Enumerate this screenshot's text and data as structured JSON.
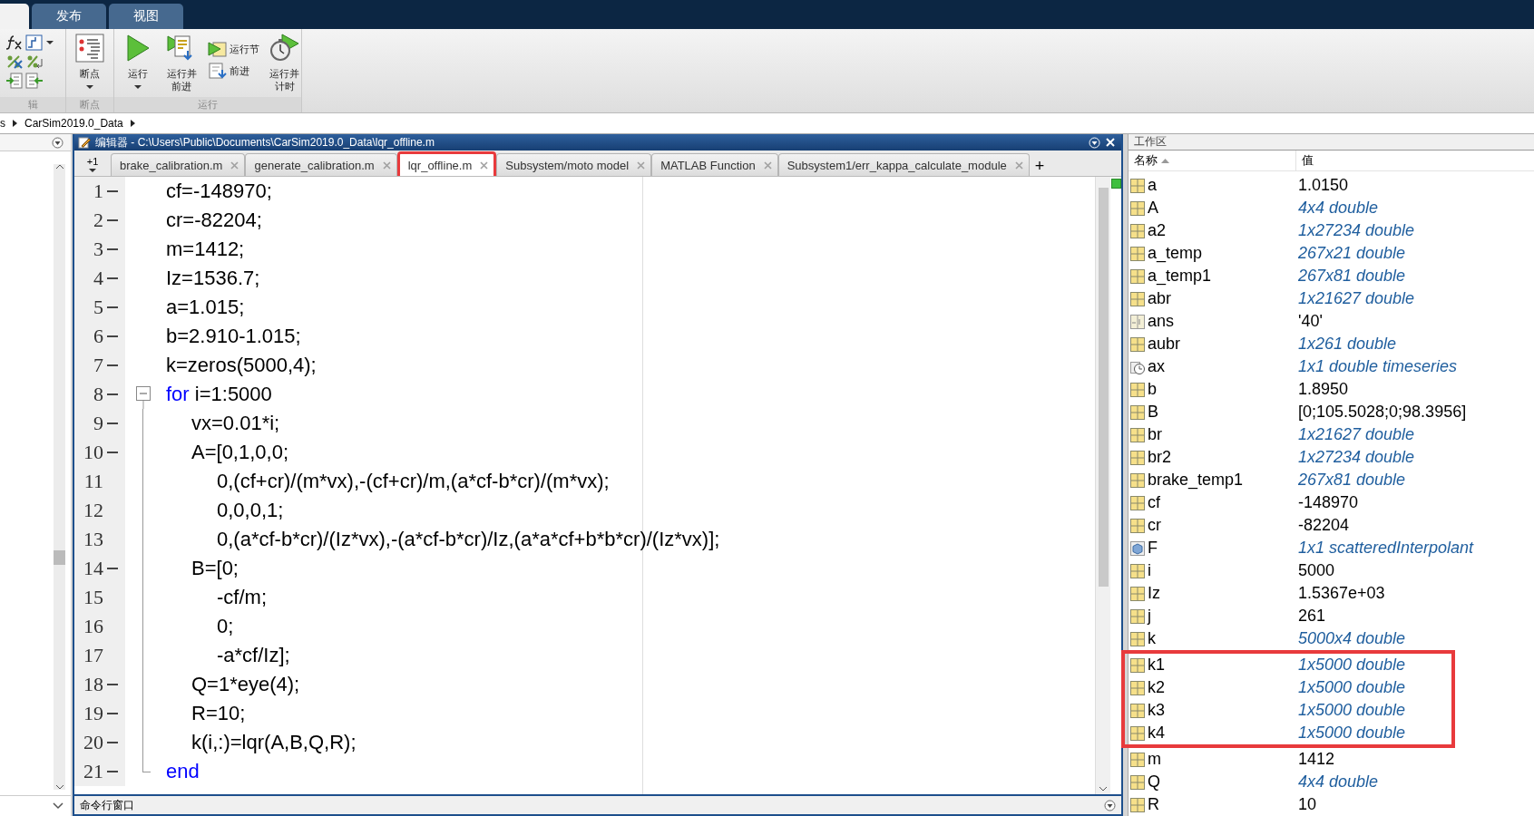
{
  "top_tabs": [
    {
      "label": "发布",
      "selected": false
    },
    {
      "label": "视图",
      "selected": false
    }
  ],
  "ribbon": {
    "groups": [
      {
        "label": "辑",
        "kind": "edit"
      },
      {
        "label": "断点",
        "kind": "buttons",
        "buttons": [
          {
            "label": "断点",
            "kind": "large",
            "dropdown": true
          }
        ]
      },
      {
        "label": "运行",
        "kind": "buttons",
        "buttons": [
          {
            "label": "运行",
            "kind": "large",
            "dropdown": true
          },
          {
            "label": "运行并前进",
            "kind": "large",
            "dropdown": false
          },
          {
            "label": "运行节",
            "kind": "small",
            "dropdown": false
          },
          {
            "label": "前进",
            "kind": "small",
            "dropdown": false
          },
          {
            "label": "运行并计时",
            "kind": "large",
            "dropdown": false
          }
        ]
      }
    ]
  },
  "breadcrumb": [
    "s",
    "CarSim2019.0_Data"
  ],
  "editor": {
    "title": "编辑器 - C:\\Users\\Public\\Documents\\CarSim2019.0_Data\\lqr_offline.m",
    "tab_count": "+1",
    "tabs": [
      {
        "label": "brake_calibration.m",
        "selected": false,
        "annotated": false
      },
      {
        "label": "generate_calibration.m",
        "selected": false,
        "annotated": false
      },
      {
        "label": "lqr_offline.m",
        "selected": true,
        "annotated": true
      },
      {
        "label": "Subsystem/moto model",
        "selected": false,
        "annotated": false
      },
      {
        "label": "MATLAB Function",
        "selected": false,
        "annotated": false
      },
      {
        "label": "Subsystem1/err_kappa_calculate_module",
        "selected": false,
        "annotated": false
      }
    ],
    "new_tab": "+",
    "lines": [
      {
        "number": "1",
        "executable": true,
        "parts": [
          {
            "kind": "plain",
            "text": "cf=-148970;"
          }
        ]
      },
      {
        "number": "2",
        "executable": true,
        "parts": [
          {
            "kind": "plain",
            "text": "cr=-82204;"
          }
        ]
      },
      {
        "number": "3",
        "executable": true,
        "parts": [
          {
            "kind": "plain",
            "text": "m=1412;"
          }
        ]
      },
      {
        "number": "4",
        "executable": true,
        "parts": [
          {
            "kind": "plain",
            "text": "Iz=1536.7;"
          }
        ]
      },
      {
        "number": "5",
        "executable": true,
        "parts": [
          {
            "kind": "plain",
            "text": "a=1.015;"
          }
        ]
      },
      {
        "number": "6",
        "executable": true,
        "parts": [
          {
            "kind": "plain",
            "text": "b=2.910-1.015;"
          }
        ]
      },
      {
        "number": "7",
        "executable": true,
        "parts": [
          {
            "kind": "plain",
            "text": "k=zeros(5000,4);"
          }
        ]
      },
      {
        "number": "8",
        "executable": true,
        "expanded": true,
        "parts": [
          {
            "kind": "keyword",
            "text": "for"
          },
          {
            "kind": "plain",
            "text": " i=1:5000"
          }
        ],
        "children": [
          {
            "number": "9",
            "executable": true,
            "parts": [
              {
                "kind": "plain",
                "text": "vx=0.01*i;"
              }
            ]
          },
          {
            "number": "10",
            "executable": true,
            "parts": [
              {
                "kind": "plain",
                "text": "A=[0,1,0,0;"
              }
            ],
            "children": [
              {
                "number": "11",
                "executable": false,
                "parts": [
                  {
                    "kind": "plain",
                    "text": "0,(cf+cr)/(m*vx),-(cf+cr)/m,(a*cf-b*cr)/(m*vx);"
                  }
                ]
              },
              {
                "number": "12",
                "executable": false,
                "parts": [
                  {
                    "kind": "plain",
                    "text": "0,0,0,1;"
                  }
                ]
              },
              {
                "number": "13",
                "executable": false,
                "parts": [
                  {
                    "kind": "plain",
                    "text": "0,(a*cf-b*cr)/(Iz*vx),-(a*cf-b*cr)/Iz,(a*a*cf+b*b*cr)/(Iz*vx)];"
                  }
                ]
              }
            ]
          },
          {
            "number": "14",
            "executable": true,
            "parts": [
              {
                "kind": "plain",
                "text": "B=[0;"
              }
            ],
            "children": [
              {
                "number": "15",
                "executable": false,
                "parts": [
                  {
                    "kind": "plain",
                    "text": "-cf/m;"
                  }
                ]
              },
              {
                "number": "16",
                "executable": false,
                "parts": [
                  {
                    "kind": "plain",
                    "text": "0;"
                  }
                ]
              },
              {
                "number": "17",
                "executable": false,
                "parts": [
                  {
                    "kind": "plain",
                    "text": "-a*cf/Iz];"
                  }
                ]
              }
            ]
          },
          {
            "number": "18",
            "executable": true,
            "parts": [
              {
                "kind": "plain",
                "text": "Q=1*eye(4);"
              }
            ]
          },
          {
            "number": "19",
            "executable": true,
            "parts": [
              {
                "kind": "plain",
                "text": "R=10;"
              }
            ]
          },
          {
            "number": "20",
            "executable": true,
            "parts": [
              {
                "kind": "plain",
                "text": "k(i,:)=lqr(A,B,Q,R);"
              }
            ]
          }
        ],
        "end_line": {
          "number": "21",
          "executable": true,
          "parts": [
            {
              "kind": "keyword",
              "text": "end"
            }
          ]
        }
      }
    ]
  },
  "command_window": {
    "title": "命令行窗口"
  },
  "workspace": {
    "title": "工作区",
    "columns": [
      {
        "label": "名称",
        "sorted": true
      },
      {
        "label": "值",
        "sorted": false
      }
    ],
    "rows": [
      {
        "name": "a",
        "value": "1.0150",
        "kind": "matrix",
        "summary": false,
        "annotated": false
      },
      {
        "name": "A",
        "value": "4x4 double",
        "kind": "matrix",
        "summary": true,
        "annotated": false
      },
      {
        "name": "a2",
        "value": "1x27234 double",
        "kind": "matrix",
        "summary": true,
        "annotated": false
      },
      {
        "name": "a_temp",
        "value": "267x21 double",
        "kind": "matrix",
        "summary": true,
        "annotated": false
      },
      {
        "name": "a_temp1",
        "value": "267x81 double",
        "kind": "matrix",
        "summary": true,
        "annotated": false
      },
      {
        "name": "abr",
        "value": "1x21627 double",
        "kind": "matrix",
        "summary": true,
        "annotated": false
      },
      {
        "name": "ans",
        "value": "'40'",
        "kind": "char",
        "summary": false,
        "annotated": false
      },
      {
        "name": "aubr",
        "value": "1x261 double",
        "kind": "matrix",
        "summary": true,
        "annotated": false
      },
      {
        "name": "ax",
        "value": "1x1 double timeseries",
        "kind": "timeseries",
        "summary": true,
        "annotated": false
      },
      {
        "name": "b",
        "value": "1.8950",
        "kind": "matrix",
        "summary": false,
        "annotated": false
      },
      {
        "name": "B",
        "value": "[0;105.5028;0;98.3956]",
        "kind": "matrix",
        "summary": false,
        "annotated": false
      },
      {
        "name": "br",
        "value": "1x21627 double",
        "kind": "matrix",
        "summary": true,
        "annotated": false
      },
      {
        "name": "br2",
        "value": "1x27234 double",
        "kind": "matrix",
        "summary": true,
        "annotated": false
      },
      {
        "name": "brake_temp1",
        "value": "267x81 double",
        "kind": "matrix",
        "summary": true,
        "annotated": false
      },
      {
        "name": "cf",
        "value": "-148970",
        "kind": "matrix",
        "summary": false,
        "annotated": false
      },
      {
        "name": "cr",
        "value": "-82204",
        "kind": "matrix",
        "summary": false,
        "annotated": false
      },
      {
        "name": "F",
        "value": "1x1 scatteredInterpolant",
        "kind": "object",
        "summary": true,
        "annotated": false
      },
      {
        "name": "i",
        "value": "5000",
        "kind": "matrix",
        "summary": false,
        "annotated": false
      },
      {
        "name": "Iz",
        "value": "1.5367e+03",
        "kind": "matrix",
        "summary": false,
        "annotated": false
      },
      {
        "name": "j",
        "value": "261",
        "kind": "matrix",
        "summary": false,
        "annotated": false
      },
      {
        "name": "k",
        "value": "5000x4 double",
        "kind": "matrix",
        "summary": true,
        "annotated": false
      },
      {
        "name": "k1",
        "value": "1x5000 double",
        "kind": "matrix",
        "summary": true,
        "annotated": true
      },
      {
        "name": "k2",
        "value": "1x5000 double",
        "kind": "matrix",
        "summary": true,
        "annotated": true
      },
      {
        "name": "k3",
        "value": "1x5000 double",
        "kind": "matrix",
        "summary": true,
        "annotated": true
      },
      {
        "name": "k4",
        "value": "1x5000 double",
        "kind": "matrix",
        "summary": true,
        "annotated": true
      },
      {
        "name": "m",
        "value": "1412",
        "kind": "matrix",
        "summary": false,
        "annotated": false
      },
      {
        "name": "Q",
        "value": "4x4 double",
        "kind": "matrix",
        "summary": true,
        "annotated": false
      },
      {
        "name": "R",
        "value": "10",
        "kind": "matrix",
        "summary": false,
        "annotated": false
      }
    ]
  }
}
